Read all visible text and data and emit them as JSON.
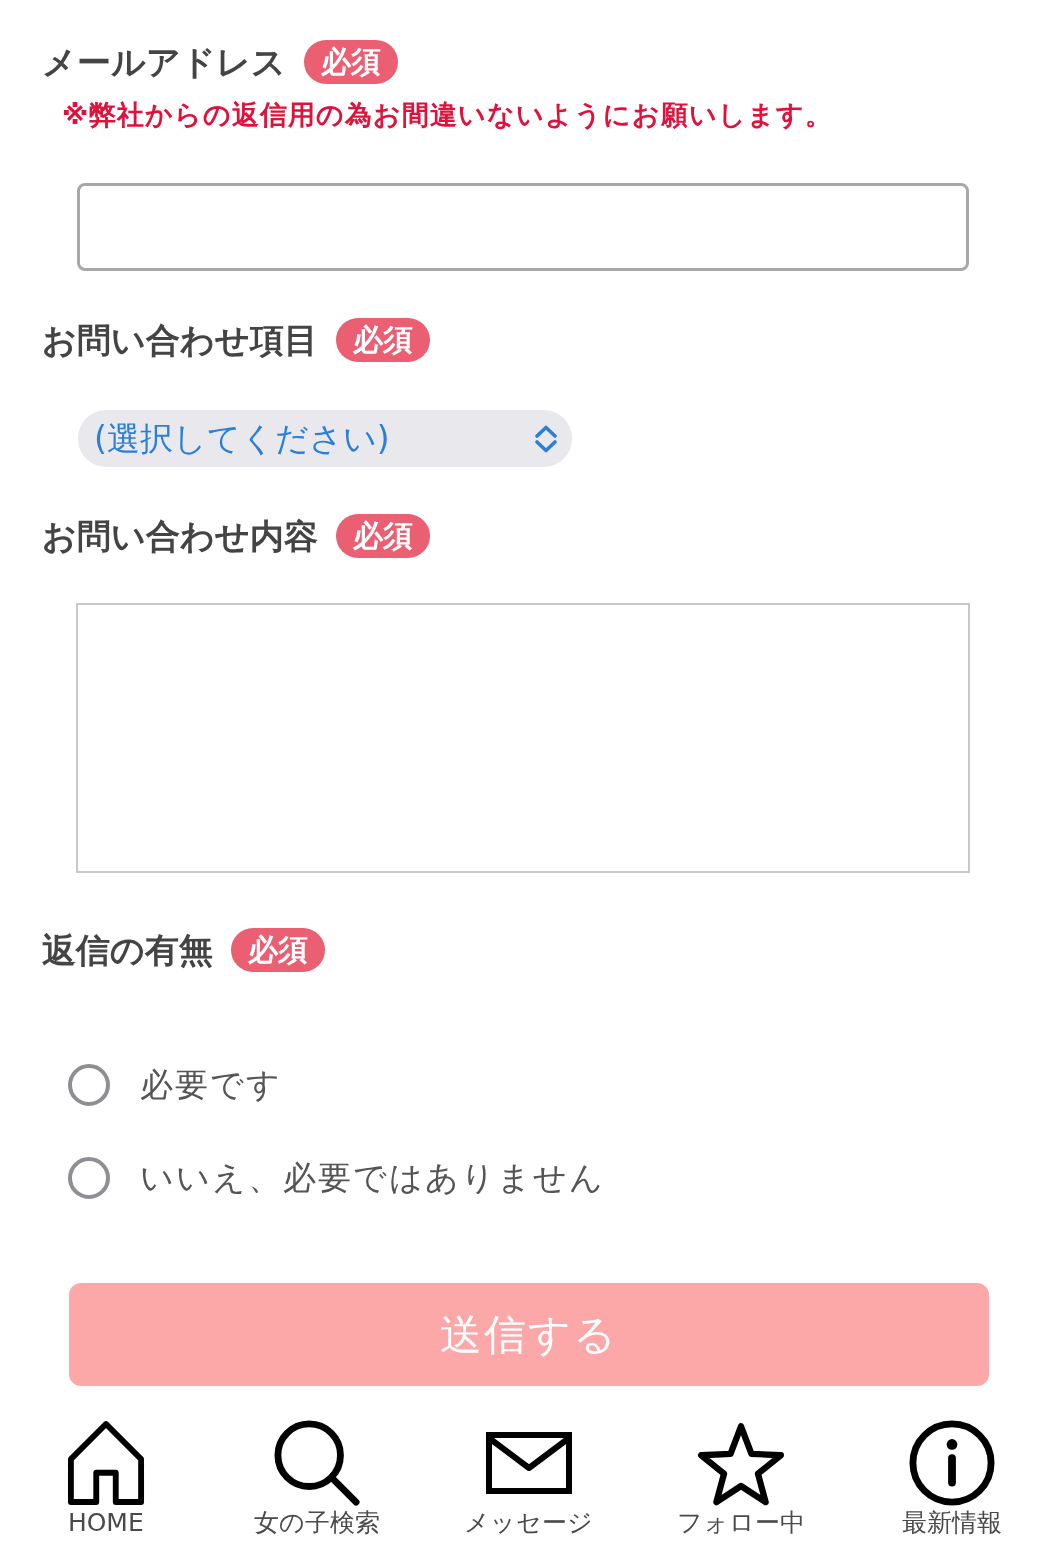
{
  "fields": [
    {
      "kind": "email",
      "label": "メールアドレス",
      "badge": "必須",
      "note": "※弊社からの返信用の為お間違いないようにお願いします。"
    },
    {
      "kind": "select",
      "label": "お問い合わせ項目",
      "badge": "必須",
      "value": "(選択してください)"
    },
    {
      "kind": "textarea",
      "label": "お問い合わせ内容",
      "badge": "必須"
    },
    {
      "kind": "radio",
      "label": "返信の有無",
      "badge": "必須",
      "options": [
        {
          "label": "必要です",
          "selected": false
        },
        {
          "label": "いいえ、必要ではありません",
          "selected": false
        }
      ]
    }
  ],
  "submit_button": {
    "label": "送信する",
    "disabled": true
  },
  "bottom_nav": [
    {
      "kind": "home",
      "label": "HOME"
    },
    {
      "kind": "search",
      "label": "女の子検索"
    },
    {
      "kind": "mail",
      "label": "メッセージ"
    },
    {
      "kind": "star",
      "label": "フォロー中"
    },
    {
      "kind": "info",
      "label": "最新情報"
    }
  ]
}
